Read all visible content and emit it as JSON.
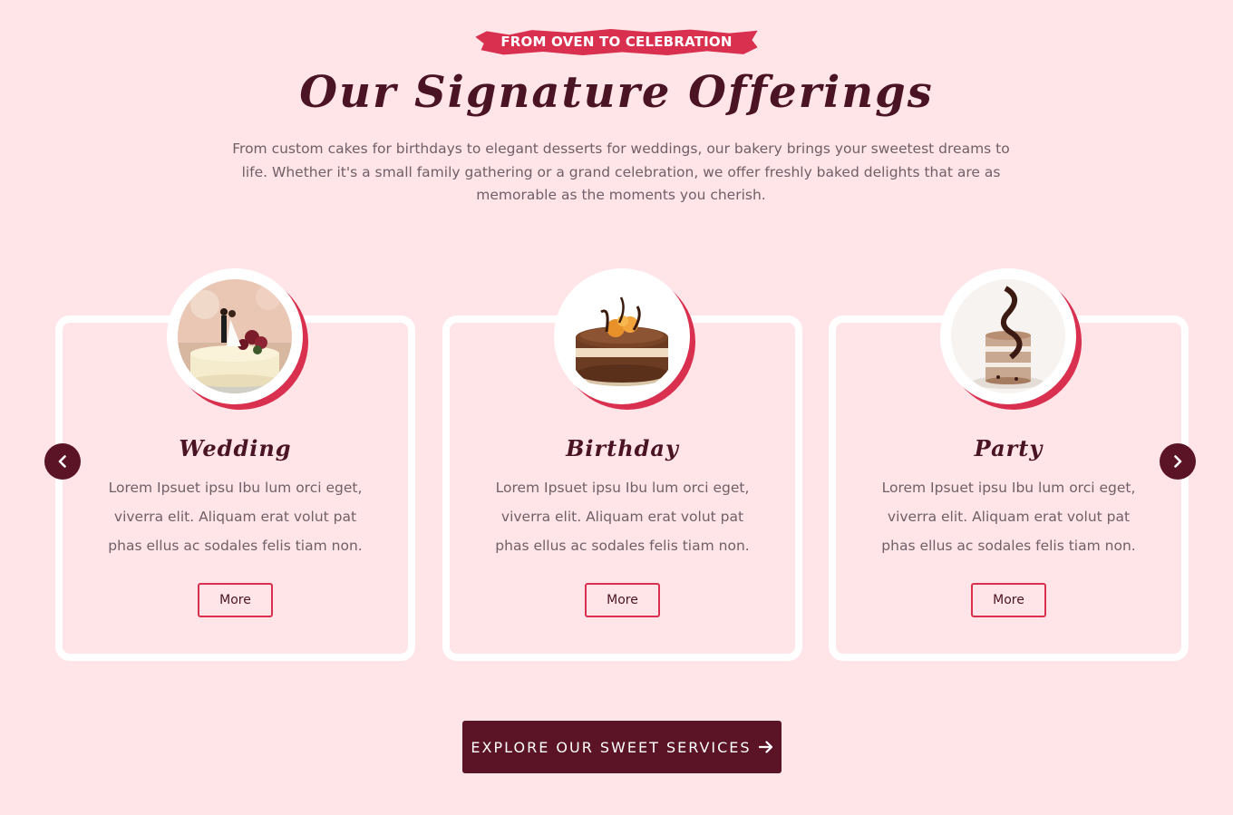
{
  "header": {
    "eyebrow": "FROM OVEN TO CELEBRATION",
    "title": "Our Signature Offerings",
    "subtitle": "From custom cakes for birthdays to elegant desserts for weddings, our bakery brings your sweetest dreams to life. Whether it's a small family gathering or a grand celebration, we offer freshly baked delights that are as memorable as the moments you cherish."
  },
  "cards": [
    {
      "title": "Wedding",
      "text": "Lorem Ipsuet ipsu Ibu lum orci eget, viverra elit. Aliquam erat volut pat phas ellus ac sodales felis tiam non.",
      "button": "More"
    },
    {
      "title": "Birthday",
      "text": "Lorem Ipsuet ipsu Ibu lum orci eget, viverra elit. Aliquam erat volut pat phas ellus ac sodales felis tiam non.",
      "button": "More"
    },
    {
      "title": "Party",
      "text": "Lorem Ipsuet ipsu Ibu lum orci eget, viverra elit. Aliquam erat volut pat phas ellus ac sodales felis tiam non.",
      "button": "More"
    }
  ],
  "cta": {
    "label": "EXPLORE OUR SWEET SERVICES"
  },
  "colors": {
    "background": "#ffe4e8",
    "accent": "#d9304f",
    "dark": "#5a1426",
    "heading": "#4a1424",
    "body_text": "#706068"
  },
  "icons": {
    "prev": "chevron-left-icon",
    "next": "chevron-right-icon",
    "cta": "arrow-right-icon"
  }
}
